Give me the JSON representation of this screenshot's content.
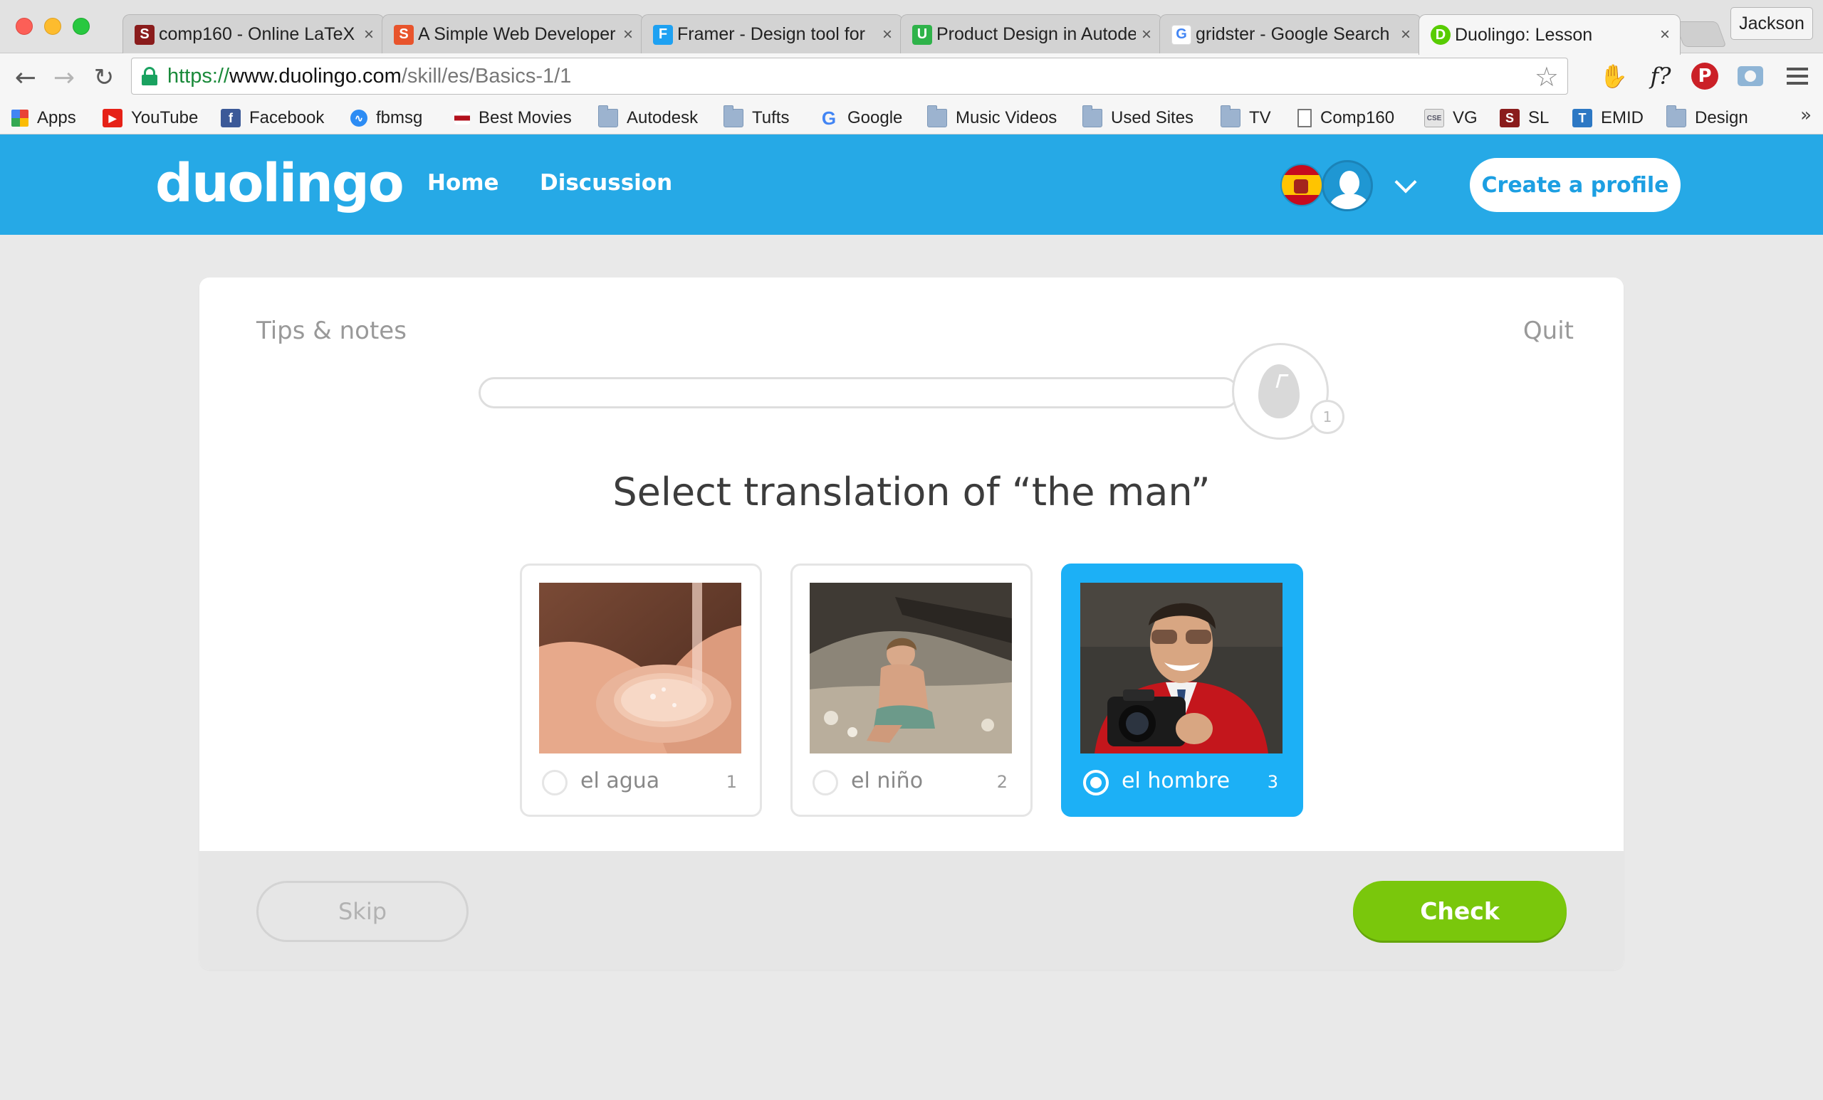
{
  "browser": {
    "tabs": [
      {
        "title": "comp160 - Online LaTeX",
        "favicon_letter": "S",
        "favicon_color": "#8a1c1c"
      },
      {
        "title": "A Simple Web Developer",
        "favicon_letter": "S",
        "favicon_color": "#e8542c"
      },
      {
        "title": "Framer - Design tool for",
        "favicon_letter": "F",
        "favicon_color": "#1ea1f2"
      },
      {
        "title": "Product Design in Autodesk",
        "favicon_letter": "U",
        "favicon_color": "#2fb34a"
      },
      {
        "title": "gridster - Google Search",
        "favicon_letter": "G",
        "favicon_color": "#ffffff"
      },
      {
        "title": "Duolingo: Lesson",
        "favicon_letter": "D",
        "favicon_color": "#58cc02"
      }
    ],
    "tab_close": "×",
    "profile_name": "Jackson",
    "url": {
      "scheme": "https://",
      "host": "www.duolingo.com",
      "path": "/skill/es/Basics-1/1"
    },
    "bookmarks": [
      {
        "label": "Apps",
        "icon": "apps-grid-icon"
      },
      {
        "label": "YouTube",
        "icon": "youtube-icon"
      },
      {
        "label": "Facebook",
        "icon": "facebook-icon"
      },
      {
        "label": "fbmsg",
        "icon": "messenger-icon"
      },
      {
        "label": "Best Movies",
        "icon": "movies-icon"
      },
      {
        "label": "Autodesk",
        "icon": "folder-icon"
      },
      {
        "label": "Tufts",
        "icon": "folder-icon"
      },
      {
        "label": "Google",
        "icon": "google-icon"
      },
      {
        "label": "Music Videos",
        "icon": "folder-icon"
      },
      {
        "label": "Used Sites",
        "icon": "folder-icon"
      },
      {
        "label": "TV",
        "icon": "folder-icon"
      },
      {
        "label": "Comp160",
        "icon": "page-icon"
      },
      {
        "label": "VG",
        "icon": "cse-icon"
      },
      {
        "label": "SL",
        "icon": "sharelatex-icon"
      },
      {
        "label": "EMID",
        "icon": "t-icon"
      },
      {
        "label": "Design",
        "icon": "folder-icon"
      }
    ],
    "bookmarks_more": "»"
  },
  "duolingo": {
    "logo": "duolingo",
    "nav": {
      "home": "Home",
      "discussion": "Discussion"
    },
    "create_profile": "Create a profile",
    "brand_color": "#1cb0f6"
  },
  "lesson": {
    "tips": "Tips & notes",
    "quit": "Quit",
    "progress": 0,
    "egg_count": "1",
    "prompt": "Select translation of “the man”",
    "choices": [
      {
        "label": "el agua",
        "number": "1",
        "selected": false,
        "image": "hands-under-water"
      },
      {
        "label": "el niño",
        "number": "2",
        "selected": false,
        "image": "child-on-beach"
      },
      {
        "label": "el hombre",
        "number": "3",
        "selected": true,
        "image": "man-with-camera"
      }
    ],
    "skip": "Skip",
    "check": "Check",
    "check_color": "#7ac70c"
  }
}
